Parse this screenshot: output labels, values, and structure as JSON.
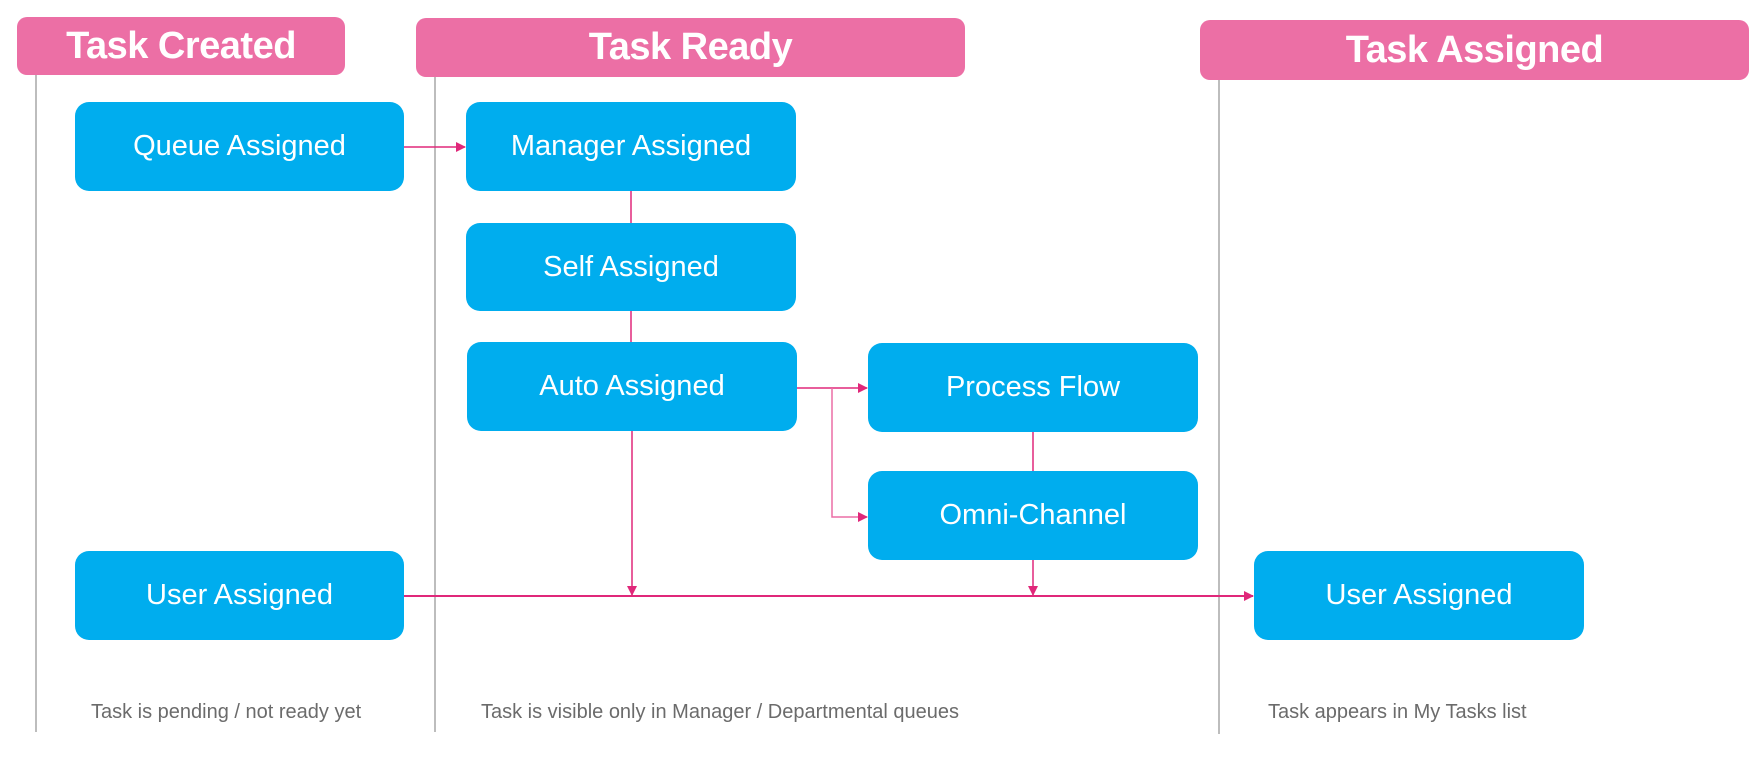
{
  "colors": {
    "header_bg": "#ec6fa5",
    "box_bg": "#00adee",
    "connector": "#e0287a",
    "lane_line": "#bdbdbd",
    "caption_text": "#6b6b6b"
  },
  "lanes": [
    {
      "id": "created",
      "title": "Task Created",
      "caption": "Task is pending / not ready yet"
    },
    {
      "id": "ready",
      "title": "Task Ready",
      "caption": "Task is visible only in Manager / Departmental queues"
    },
    {
      "id": "assigned",
      "title": "Task Assigned",
      "caption": "Task appears in My Tasks list"
    }
  ],
  "nodes": {
    "queue_assigned": "Queue Assigned",
    "manager_assigned": "Manager Assigned",
    "self_assigned": "Self Assigned",
    "auto_assigned": "Auto Assigned",
    "process_flow": "Process Flow",
    "omni_channel": "Omni-Channel",
    "user_assigned_created": "User Assigned",
    "user_assigned_final": "User Assigned"
  },
  "edges": [
    {
      "from": "queue_assigned",
      "to": "manager_assigned",
      "arrow": true
    },
    {
      "from": "manager_assigned",
      "to": "self_assigned",
      "arrow": false
    },
    {
      "from": "self_assigned",
      "to": "auto_assigned",
      "arrow": false
    },
    {
      "from": "auto_assigned",
      "to": "process_flow",
      "arrow": true
    },
    {
      "from": "auto_assigned",
      "to": "omni_channel",
      "arrow": true
    },
    {
      "from": "process_flow",
      "to": "omni_channel",
      "arrow": false
    },
    {
      "from": "auto_assigned",
      "to": "main_line",
      "arrow": true
    },
    {
      "from": "omni_channel",
      "to": "main_line",
      "arrow": true
    },
    {
      "from": "user_assigned_created",
      "to": "user_assigned_final",
      "arrow": true
    }
  ]
}
